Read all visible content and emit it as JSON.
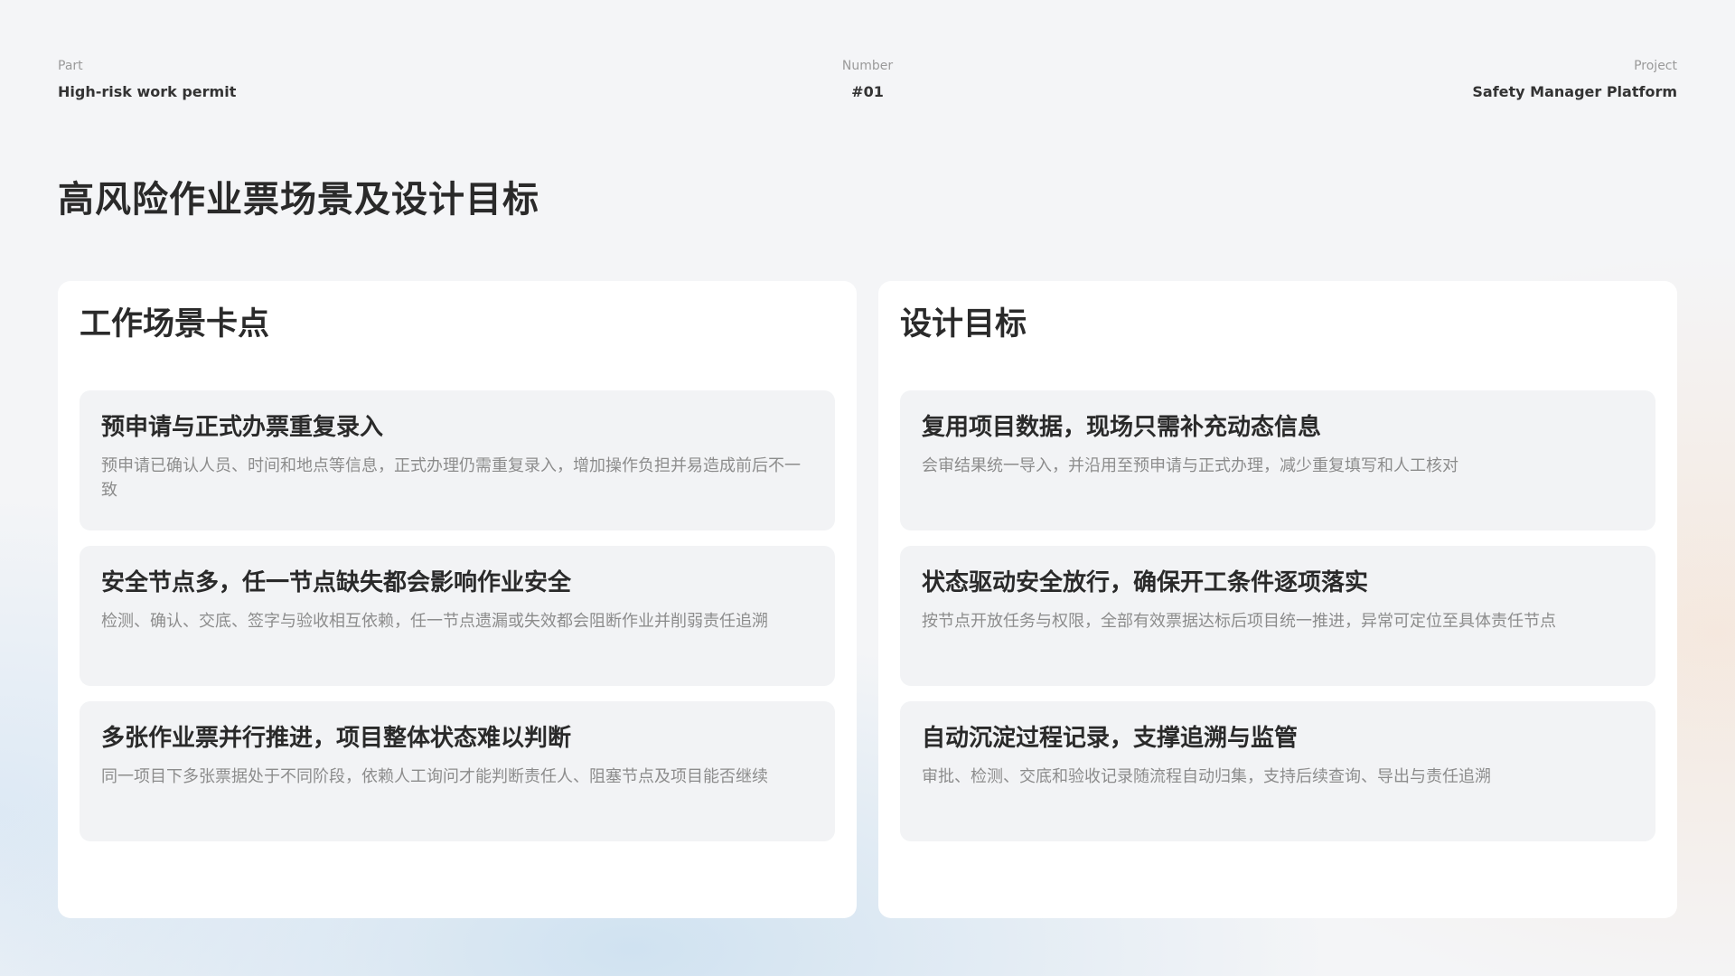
{
  "header": {
    "part_label": "Part",
    "part_value": "High-risk work permit",
    "number_label": "Number",
    "number_value": "#01",
    "project_label": "Project",
    "project_value": "Safety Manager Platform"
  },
  "page_title": "高风险作业票场景及设计目标",
  "left_panel": {
    "title": "工作场景卡点",
    "cards": [
      {
        "title": "预申请与正式办票重复录入",
        "desc": "预申请已确认人员、时间和地点等信息，正式办理仍需重复录入，增加操作负担并易造成前后不一致"
      },
      {
        "title": "安全节点多，任一节点缺失都会影响作业安全",
        "desc": "检测、确认、交底、签字与验收相互依赖，任一节点遗漏或失效都会阻断作业并削弱责任追溯"
      },
      {
        "title": "多张作业票并行推进，项目整体状态难以判断",
        "desc": "同一项目下多张票据处于不同阶段，依赖人工询问才能判断责任人、阻塞节点及项目能否继续"
      }
    ]
  },
  "right_panel": {
    "title": "设计目标",
    "cards": [
      {
        "title": "复用项目数据，现场只需补充动态信息",
        "desc": "会审结果统一导入，并沿用至预申请与正式办理，减少重复填写和人工核对"
      },
      {
        "title": "状态驱动安全放行，确保开工条件逐项落实",
        "desc": "按节点开放任务与权限，全部有效票据达标后项目统一推进，异常可定位至具体责任节点"
      },
      {
        "title": "自动沉淀过程记录，支撑追溯与监管",
        "desc": "审批、检测、交底和验收记录随流程自动归集，支持后续查询、导出与责任追溯"
      }
    ]
  }
}
